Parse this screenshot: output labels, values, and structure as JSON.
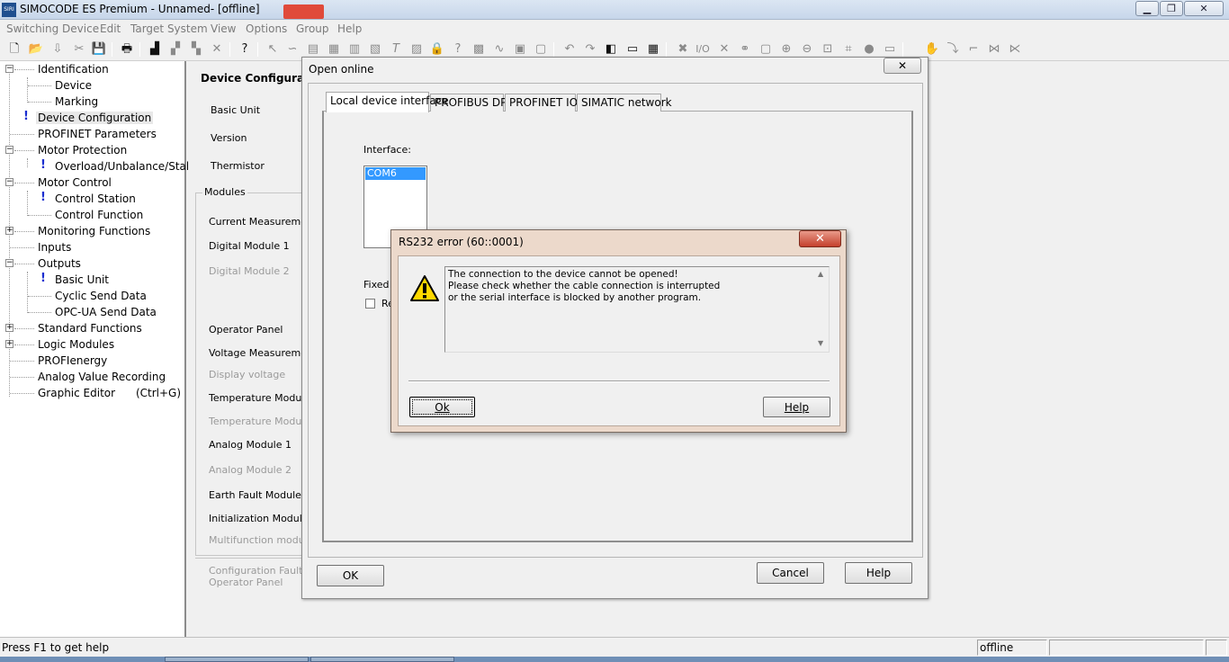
{
  "titlebar": {
    "icon_text": "SIRI",
    "title": "SIMOCODE ES Premium - Unnamed- [offline]",
    "minimize_icon": "minimize-icon",
    "restore_icon": "restore-icon",
    "close_icon": "close-icon"
  },
  "menu": [
    "Switching Device",
    "Edit",
    "Target System",
    "View",
    "Options",
    "Group",
    "Help"
  ],
  "tree": {
    "items": [
      {
        "label": "Identification"
      },
      {
        "label": "Device"
      },
      {
        "label": "Marking"
      },
      {
        "label": "Device Configuration",
        "mark": "!"
      },
      {
        "label": "PROFINET Parameters"
      },
      {
        "label": "Motor Protection"
      },
      {
        "label": "Overload/Unbalance/Stall",
        "mark": "!"
      },
      {
        "label": "Motor Control"
      },
      {
        "label": "Control Station",
        "mark": "!"
      },
      {
        "label": "Control Function"
      },
      {
        "label": "Monitoring Functions"
      },
      {
        "label": "Inputs"
      },
      {
        "label": "Outputs"
      },
      {
        "label": "Basic Unit",
        "mark": "!"
      },
      {
        "label": "Cyclic Send Data"
      },
      {
        "label": "OPC-UA Send Data"
      },
      {
        "label": "Standard Functions"
      },
      {
        "label": "Logic Modules"
      },
      {
        "label": "PROFIenergy"
      },
      {
        "label": "Analog Value Recording"
      },
      {
        "label": "Graphic Editor      (Ctrl+G)"
      }
    ]
  },
  "main": {
    "title": "Device Configuratio",
    "fields": [
      "Basic Unit",
      "Version",
      "Thermistor"
    ],
    "modules_title": "Modules",
    "modules": [
      {
        "label": "Current Measurement",
        "enabled": true
      },
      {
        "label": "Digital Module 1",
        "enabled": true
      },
      {
        "label": "Digital Module 2",
        "enabled": false
      },
      {
        "label": "Operator Panel",
        "enabled": true
      },
      {
        "label": "Voltage Measurement",
        "enabled": true
      },
      {
        "label": "Display voltage",
        "enabled": false
      },
      {
        "label": "Temperature Module",
        "enabled": true
      },
      {
        "label": "Temperature Module",
        "enabled": false
      },
      {
        "label": "Analog Module 1",
        "enabled": true
      },
      {
        "label": "Analog Module 2",
        "enabled": false
      },
      {
        "label": "Earth Fault Module",
        "enabled": true
      },
      {
        "label": "Initialization Module",
        "enabled": true
      },
      {
        "label": "Multifunction module",
        "enabled": false
      }
    ],
    "config_fault_line1": "Configuration Fault be",
    "config_fault_line2": "Operator Panel"
  },
  "open_online": {
    "title": "Open online",
    "close_glyph": "✕",
    "tabs": [
      "Local device interface",
      "PROFIBUS DP",
      "PROFINET IO",
      "SIMATIC network"
    ],
    "interface_label": "Interface:",
    "interface_options": [
      "COM6"
    ],
    "fixed_label": "Fixed a",
    "checkbox_label": "Re",
    "ok": "OK",
    "cancel": "Cancel",
    "help": "Help"
  },
  "error_dialog": {
    "title": "RS232 error  (60::0001)",
    "close_glyph": "✕",
    "icon": "warning-icon",
    "message": [
      "The connection to the device cannot be opened!",
      "Please check whether the cable connection is interrupted",
      "or the serial interface is blocked by another program."
    ],
    "ok": "Ok",
    "help": "Help"
  },
  "statusbar": {
    "help_text": "Press F1 to get help",
    "mode": "offline"
  }
}
